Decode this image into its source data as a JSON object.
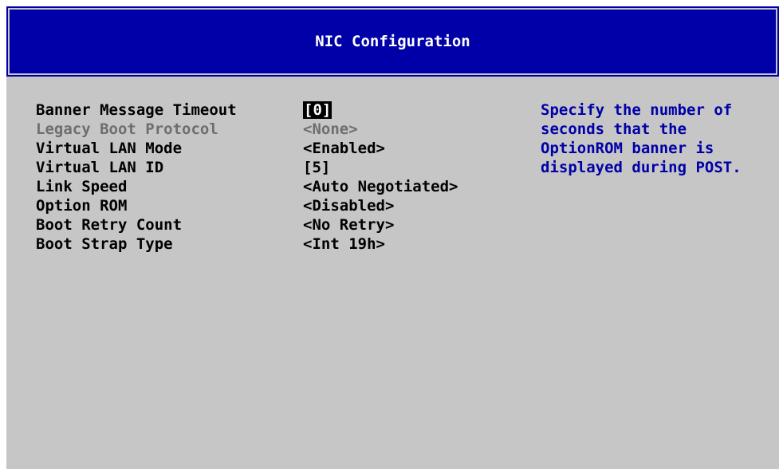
{
  "title": "NIC Configuration",
  "settings": [
    {
      "label": "Banner Message Timeout",
      "value": "[0]",
      "state": "selected"
    },
    {
      "label": "Legacy Boot Protocol",
      "value": "<None>",
      "state": "disabled"
    },
    {
      "label": "Virtual LAN Mode",
      "value": "<Enabled>",
      "state": "normal"
    },
    {
      "label": "Virtual LAN ID",
      "value": "[5]",
      "state": "normal"
    },
    {
      "label": "Link Speed",
      "value": "<Auto Negotiated>",
      "state": "normal"
    },
    {
      "label": "Option ROM",
      "value": "<Disabled>",
      "state": "normal"
    },
    {
      "label": "Boot Retry Count",
      "value": "<No Retry>",
      "state": "normal"
    },
    {
      "label": "Boot Strap Type",
      "value": "<Int 19h>",
      "state": "normal"
    }
  ],
  "help_lines": [
    "Specify the number of",
    "seconds that the",
    "OptionROM banner is",
    "displayed during POST."
  ],
  "colors": {
    "background": "#c6c6c6",
    "title_bar": "#0000a8",
    "help_text": "#0000a8",
    "disabled_text": "#6e6e6e",
    "selection_bg": "#000000",
    "selection_fg": "#ffffff"
  }
}
